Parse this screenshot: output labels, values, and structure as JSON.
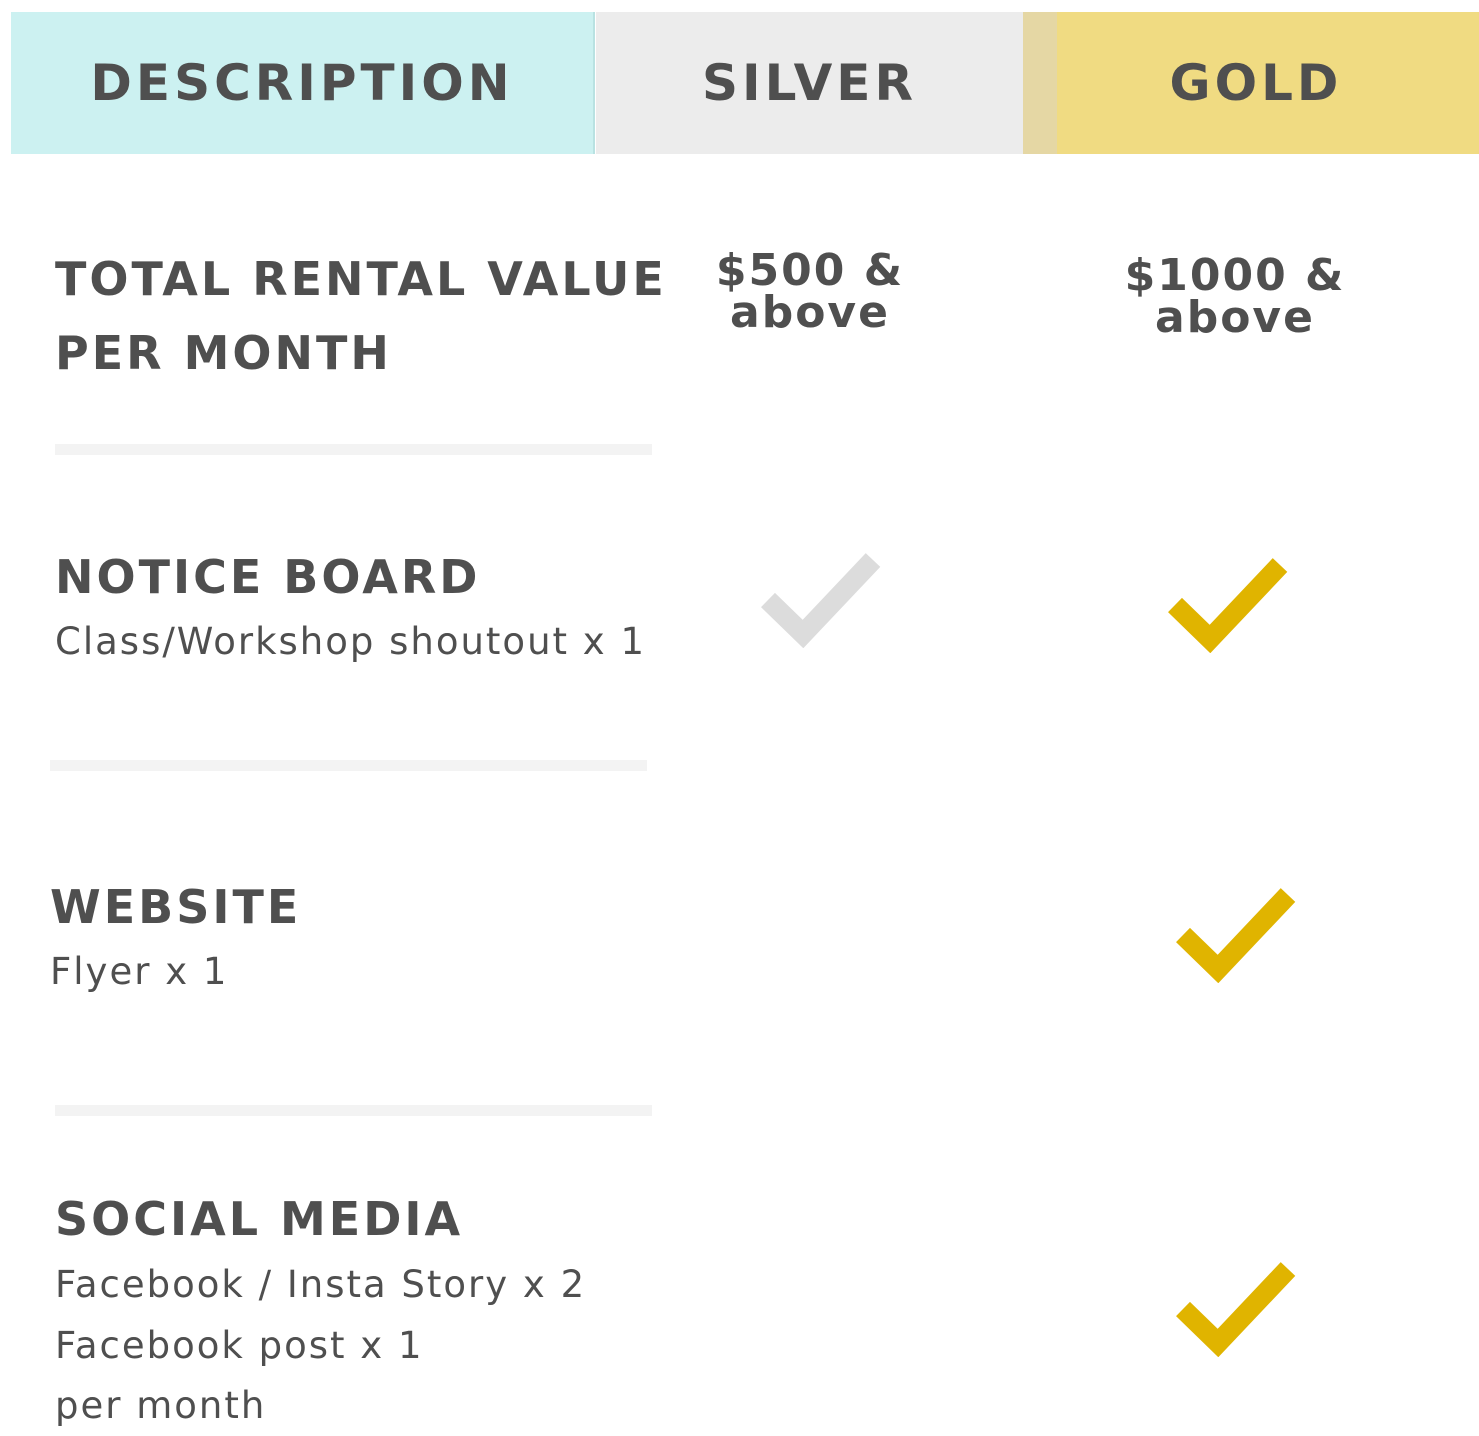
{
  "header": {
    "description": "DESCRIPTION",
    "silver": "SILVER",
    "gold": "GOLD"
  },
  "rows": [
    {
      "title_line1": "TOTAL RENTAL VALUE",
      "title_line2": "PER MONTH",
      "silver_line1": "$500 &",
      "silver_line2": "above",
      "gold_line1": "$1000 &",
      "gold_line2": "above"
    },
    {
      "title": "NOTICE BOARD",
      "subtitle": "Class/Workshop shoutout x 1",
      "silver_included": true,
      "gold_included": true
    },
    {
      "title": "WEBSITE",
      "subtitle": "Flyer x 1",
      "silver_included": false,
      "gold_included": true
    },
    {
      "title": "SOCIAL MEDIA",
      "subtitle_lines": [
        "Facebook / Insta Story x 2",
        "Facebook post x 1",
        "per month"
      ],
      "silver_included": false,
      "gold_included": true
    }
  ],
  "colors": {
    "description_header": "#ccf1f1",
    "silver_header": "#ececec",
    "gold_header": "#f0db82",
    "silver_check": "#dcdcdc",
    "gold_check": "#e0b400",
    "text": "#4f4f4f"
  },
  "icons": {
    "silver_check": "checkmark-icon",
    "gold_check": "checkmark-icon"
  }
}
